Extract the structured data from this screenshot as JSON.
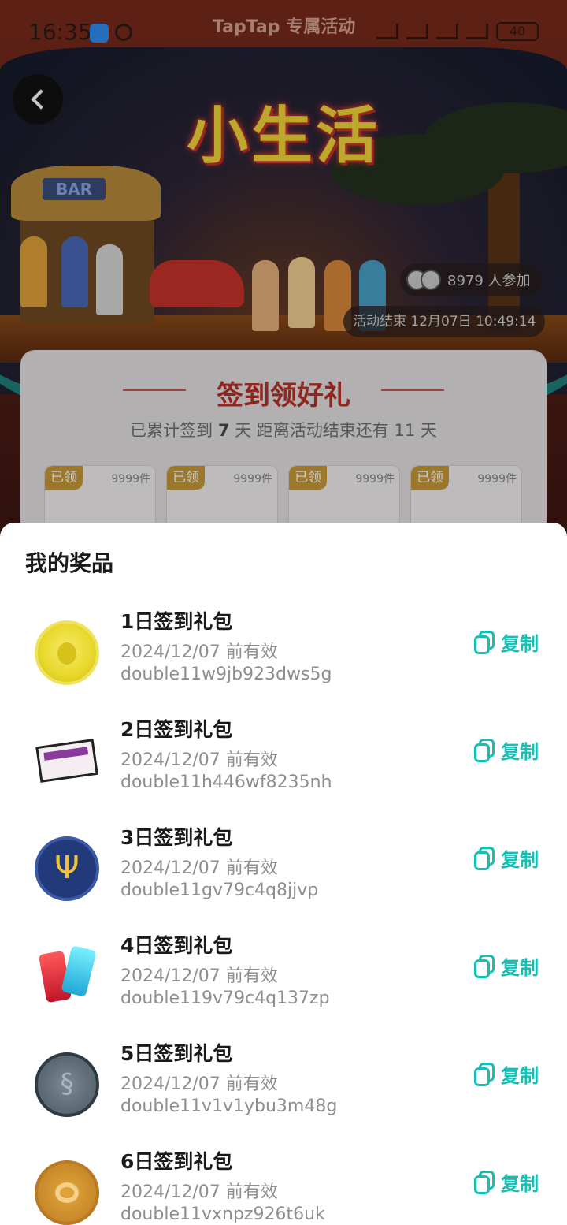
{
  "status_bar": {
    "time": "16:35",
    "brand": "TapTap 专属活动",
    "battery": "40"
  },
  "banner": {
    "title": "小生活",
    "bar_sign": "BAR",
    "participants": "8979 人参加",
    "ends_at": "活动结束 12月07日 10:49:14"
  },
  "checkin_card": {
    "title": "签到领好礼",
    "summary_prefix": "已累计签到",
    "days_count": "7",
    "summary_mid": "天  距离活动结束还有 11 天",
    "tiles": [
      {
        "status": "已领",
        "qty": "9999件"
      },
      {
        "status": "已领",
        "qty": "9999件"
      },
      {
        "status": "已领",
        "qty": "9999件"
      },
      {
        "status": "已领",
        "qty": "9999件"
      }
    ]
  },
  "sheet": {
    "title": "我的奖品",
    "copy_label": "复制",
    "prizes": [
      {
        "name": "1日签到礼包",
        "valid": "2024/12/07 前有效",
        "code": "double11w9jb923dws5g",
        "icon": "gold-coin-icon"
      },
      {
        "name": "2日签到礼包",
        "valid": "2024/12/07 前有效",
        "code": "double11h446wf8235nh",
        "icon": "ticket-icon"
      },
      {
        "name": "3日签到礼包",
        "valid": "2024/12/07 前有效",
        "code": "double11gv79c4q8jjvp",
        "icon": "trident-badge-icon"
      },
      {
        "name": "4日签到礼包",
        "valid": "2024/12/07 前有效",
        "code": "double119v79c4q137zp",
        "icon": "crystal-icon"
      },
      {
        "name": "5日签到礼包",
        "valid": "2024/12/07 前有效",
        "code": "double11v1v1ybu3m48g",
        "icon": "grey-coin-icon"
      },
      {
        "name": "6日签到礼包",
        "valid": "2024/12/07 前有效",
        "code": "double11vxnpz926t6uk",
        "icon": "bronze-coin-icon"
      }
    ]
  },
  "colors": {
    "accent": "#14bfb6",
    "title_red": "#b8332a",
    "badge_gold": "#c89a3a"
  }
}
